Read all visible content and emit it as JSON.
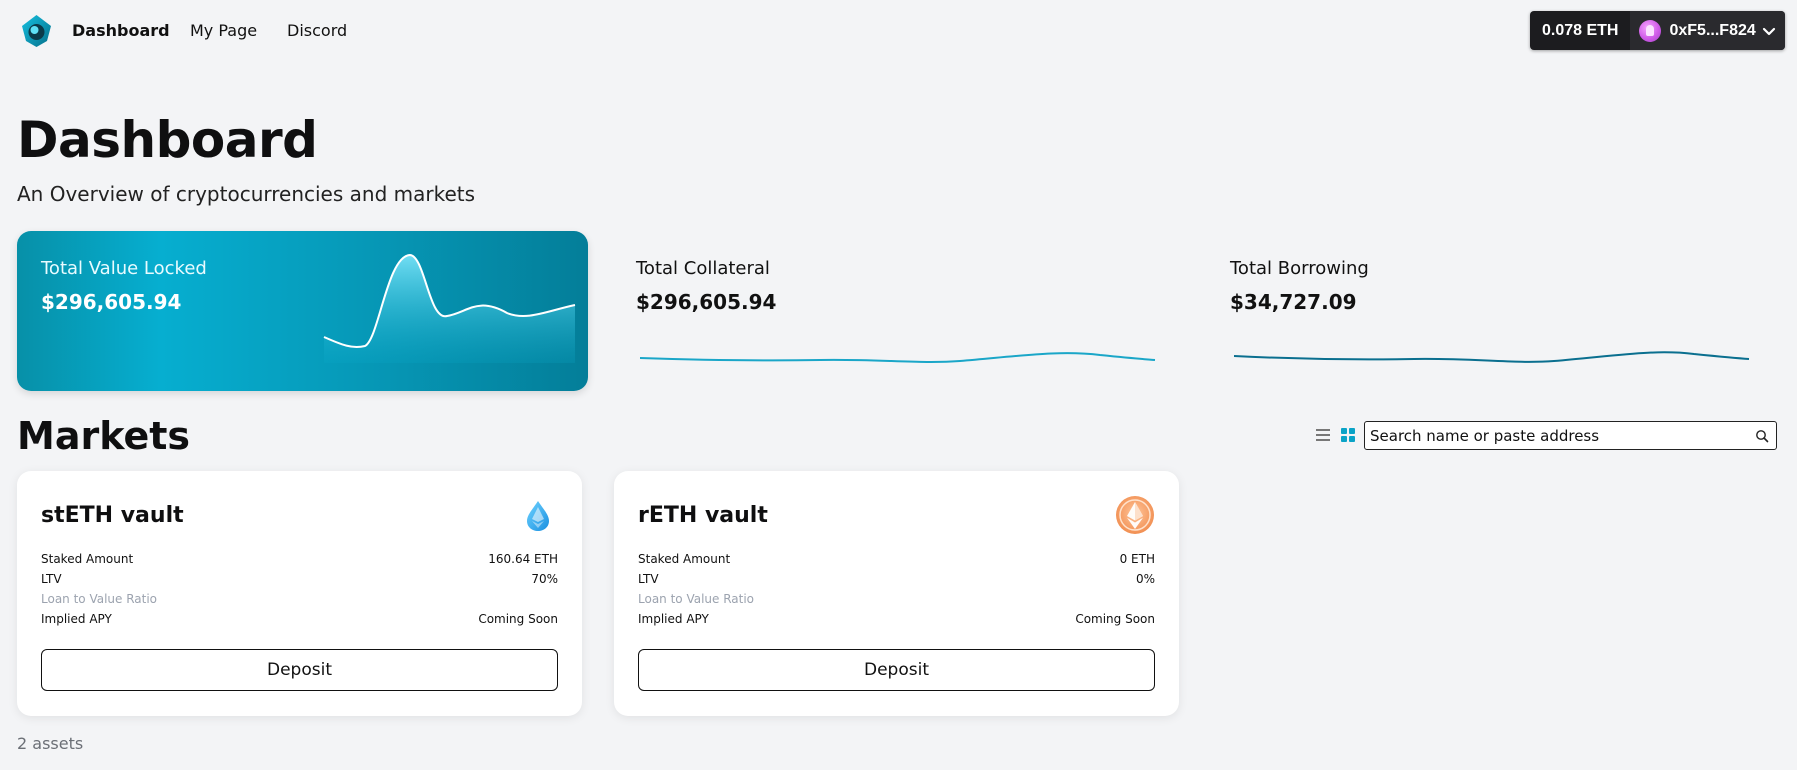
{
  "nav": {
    "links": [
      "Dashboard",
      "My Page",
      "Discord"
    ],
    "active": "Dashboard"
  },
  "wallet": {
    "balance": "0.078 ETH",
    "address": "0xF5...F824"
  },
  "header": {
    "title": "Dashboard",
    "subtitle": "An Overview of cryptocurrencies and markets"
  },
  "stats": {
    "tvl": {
      "label": "Total Value Locked",
      "value": "$296,605.94"
    },
    "collateral": {
      "label": "Total Collateral",
      "value": "$296,605.94"
    },
    "borrowing": {
      "label": "Total Borrowing",
      "value": "$34,727.09"
    }
  },
  "markets": {
    "title": "Markets",
    "search_placeholder": "Search name or paste address",
    "vaults": [
      {
        "name": "stETH vault",
        "icon": "steth-drop-icon",
        "rows": [
          {
            "label": "Staked Amount",
            "value": "160.64 ETH"
          },
          {
            "label": "LTV",
            "value": "70%"
          },
          {
            "label": "Loan to Value Ratio",
            "value": ""
          },
          {
            "label": "Implied APY",
            "value": "Coming Soon"
          }
        ],
        "button": "Deposit"
      },
      {
        "name": "rETH vault",
        "icon": "reth-ethereum-icon",
        "rows": [
          {
            "label": "Staked Amount",
            "value": "0 ETH"
          },
          {
            "label": "LTV",
            "value": "0%"
          },
          {
            "label": "Loan to Value Ratio",
            "value": ""
          },
          {
            "label": "Implied APY",
            "value": "Coming Soon"
          }
        ],
        "button": "Deposit"
      }
    ],
    "asset_count": "2 assets"
  },
  "colors": {
    "accent": "#06aed0",
    "accent_dark": "#047e99",
    "collateral_line": "#1aa6c8",
    "borrowing_line": "#0a6f8f",
    "background": "#f3f4f6"
  }
}
